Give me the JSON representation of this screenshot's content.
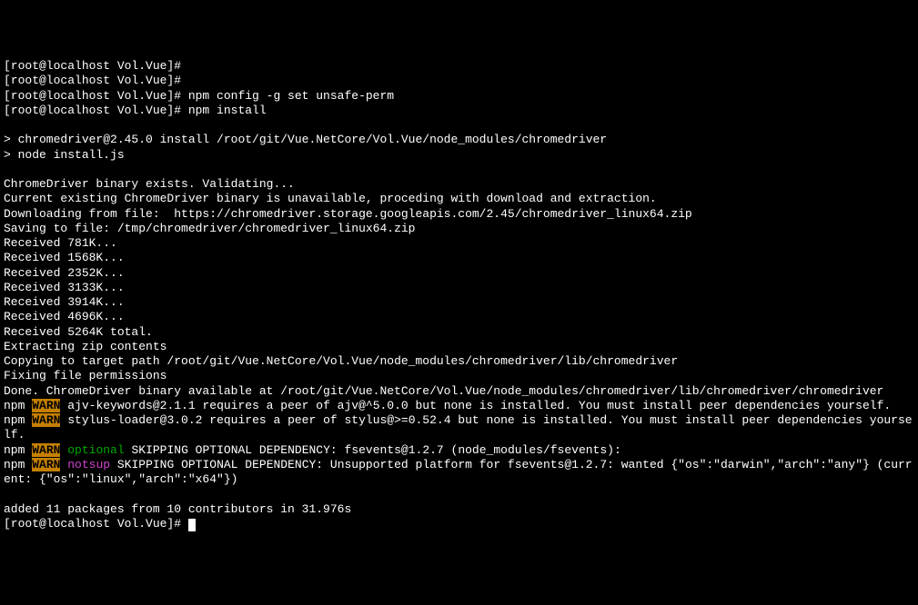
{
  "lines": [
    {
      "segments": [
        {
          "t": "[root@localhost Vol.Vue]#"
        }
      ]
    },
    {
      "segments": [
        {
          "t": "[root@localhost Vol.Vue]#"
        }
      ]
    },
    {
      "segments": [
        {
          "t": "[root@localhost Vol.Vue]# npm config -g set unsafe-perm"
        }
      ]
    },
    {
      "segments": [
        {
          "t": "[root@localhost Vol.Vue]# npm install"
        }
      ]
    },
    {
      "segments": [
        {
          "t": " "
        }
      ]
    },
    {
      "segments": [
        {
          "t": "> chromedriver@2.45.0 install /root/git/Vue.NetCore/Vol.Vue/node_modules/chromedriver"
        }
      ]
    },
    {
      "segments": [
        {
          "t": "> node install.js"
        }
      ]
    },
    {
      "segments": [
        {
          "t": " "
        }
      ]
    },
    {
      "segments": [
        {
          "t": "ChromeDriver binary exists. Validating..."
        }
      ]
    },
    {
      "segments": [
        {
          "t": "Current existing ChromeDriver binary is unavailable, proceding with download and extraction."
        }
      ]
    },
    {
      "segments": [
        {
          "t": "Downloading from file:  https://chromedriver.storage.googleapis.com/2.45/chromedriver_linux64.zip"
        }
      ]
    },
    {
      "segments": [
        {
          "t": "Saving to file: /tmp/chromedriver/chromedriver_linux64.zip"
        }
      ]
    },
    {
      "segments": [
        {
          "t": "Received 781K..."
        }
      ]
    },
    {
      "segments": [
        {
          "t": "Received 1568K..."
        }
      ]
    },
    {
      "segments": [
        {
          "t": "Received 2352K..."
        }
      ]
    },
    {
      "segments": [
        {
          "t": "Received 3133K..."
        }
      ]
    },
    {
      "segments": [
        {
          "t": "Received 3914K..."
        }
      ]
    },
    {
      "segments": [
        {
          "t": "Received 4696K..."
        }
      ]
    },
    {
      "segments": [
        {
          "t": "Received 5264K total."
        }
      ]
    },
    {
      "segments": [
        {
          "t": "Extracting zip contents"
        }
      ]
    },
    {
      "segments": [
        {
          "t": "Copying to target path /root/git/Vue.NetCore/Vol.Vue/node_modules/chromedriver/lib/chromedriver"
        }
      ]
    },
    {
      "segments": [
        {
          "t": "Fixing file permissions"
        }
      ]
    },
    {
      "segments": [
        {
          "t": "Done. ChromeDriver binary available at /root/git/Vue.NetCore/Vol.Vue/node_modules/chromedriver/lib/chromedriver/chromedriver"
        }
      ]
    },
    {
      "segments": [
        {
          "t": "npm "
        },
        {
          "t": "WARN",
          "cls": "warn"
        },
        {
          "t": " ajv-keywords@2.1.1 requires a peer of ajv@^5.0.0 but none is installed. You must install peer dependencies yourself."
        }
      ]
    },
    {
      "segments": [
        {
          "t": "npm "
        },
        {
          "t": "WARN",
          "cls": "warn"
        },
        {
          "t": " stylus-loader@3.0.2 requires a peer of stylus@>=0.52.4 but none is installed. You must install peer dependencies yourse"
        }
      ]
    },
    {
      "segments": [
        {
          "t": "lf."
        }
      ]
    },
    {
      "segments": [
        {
          "t": "npm "
        },
        {
          "t": "WARN",
          "cls": "warn"
        },
        {
          "t": " "
        },
        {
          "t": "optional",
          "cls": "green"
        },
        {
          "t": " SKIPPING OPTIONAL DEPENDENCY: fsevents@1.2.7 (node_modules/fsevents):"
        }
      ]
    },
    {
      "segments": [
        {
          "t": "npm "
        },
        {
          "t": "WARN",
          "cls": "warn"
        },
        {
          "t": " "
        },
        {
          "t": "notsup",
          "cls": "magenta"
        },
        {
          "t": " SKIPPING OPTIONAL DEPENDENCY: Unsupported platform for fsevents@1.2.7: wanted {\"os\":\"darwin\",\"arch\":\"any\"} (curr"
        }
      ]
    },
    {
      "segments": [
        {
          "t": "ent: {\"os\":\"linux\",\"arch\":\"x64\"})"
        }
      ]
    },
    {
      "segments": [
        {
          "t": " "
        }
      ]
    },
    {
      "segments": [
        {
          "t": "added 11 packages from 10 contributors in 31.976s"
        }
      ]
    },
    {
      "segments": [
        {
          "t": "[root@localhost Vol.Vue]# "
        }
      ],
      "cursor": true
    }
  ]
}
